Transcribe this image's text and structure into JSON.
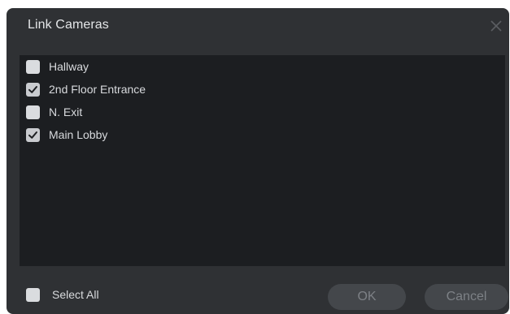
{
  "dialog": {
    "title": "Link Cameras",
    "close_icon": "close-icon"
  },
  "cameras": [
    {
      "label": "Hallway",
      "checked": false
    },
    {
      "label": "2nd Floor Entrance",
      "checked": true
    },
    {
      "label": "N. Exit",
      "checked": false
    },
    {
      "label": "Main Lobby",
      "checked": true
    }
  ],
  "footer": {
    "select_all_label": "Select All",
    "select_all_checked": false,
    "ok_label": "OK",
    "cancel_label": "Cancel"
  },
  "colors": {
    "dialog_bg": "#2f3134",
    "list_bg": "#1c1e21",
    "text": "#d8dadd",
    "button_bg": "#44474b",
    "button_text": "#7d8186"
  }
}
